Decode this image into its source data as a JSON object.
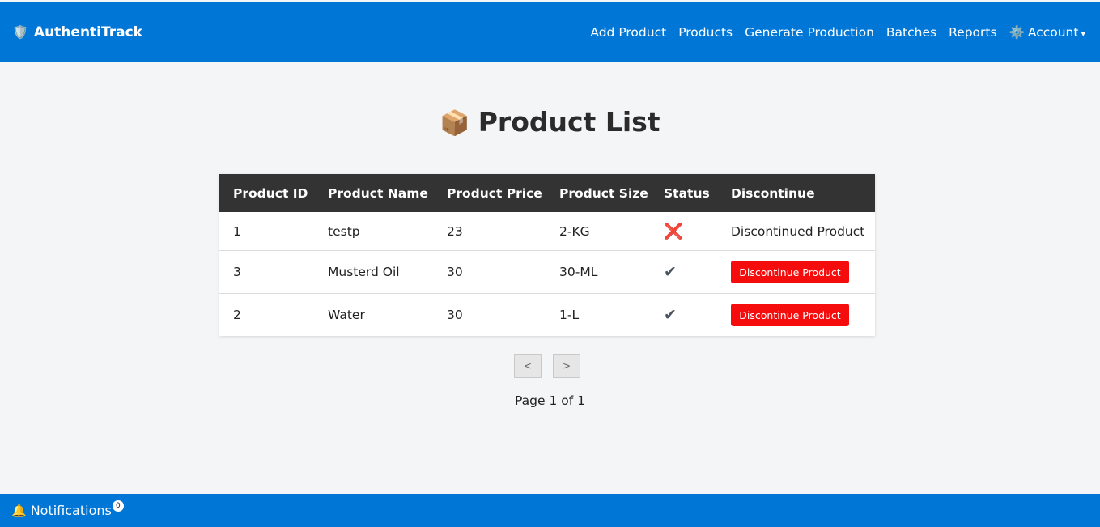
{
  "header": {
    "brand_icon": "🛡️",
    "brand": "AuthentiTrack",
    "nav": {
      "add_product": "Add Product",
      "products": "Products",
      "generate_production": "Generate Production",
      "batches": "Batches",
      "reports": "Reports",
      "account_icon": "⚙️",
      "account": "Account",
      "account_caret": "▾"
    }
  },
  "title": {
    "icon": "📦",
    "text": "Product List"
  },
  "table": {
    "headers": [
      "Product ID",
      "Product Name",
      "Product Price",
      "Product Size",
      "Status",
      "Discontinue"
    ],
    "rows": [
      {
        "id": "1",
        "name": "testp",
        "price": "23",
        "size": "2-KG",
        "status_icon": "❌",
        "discontinue": "Discontinued Product"
      },
      {
        "id": "3",
        "name": "Musterd Oil",
        "price": "30",
        "size": "30-ML",
        "status_icon": "✔",
        "discontinue": "Discontinue Product"
      },
      {
        "id": "2",
        "name": "Water",
        "price": "30",
        "size": "1-L",
        "status_icon": "✔",
        "discontinue": "Discontinue Product"
      }
    ]
  },
  "pagination": {
    "prev": "<",
    "next": ">",
    "info": "Page 1 of 1"
  },
  "footer": {
    "bell_icon": "🔔",
    "notifications": "Notifications",
    "count": "0"
  },
  "colors": {
    "primary": "#0076d6",
    "header_dark": "#333333",
    "danger": "#f50c0c"
  }
}
